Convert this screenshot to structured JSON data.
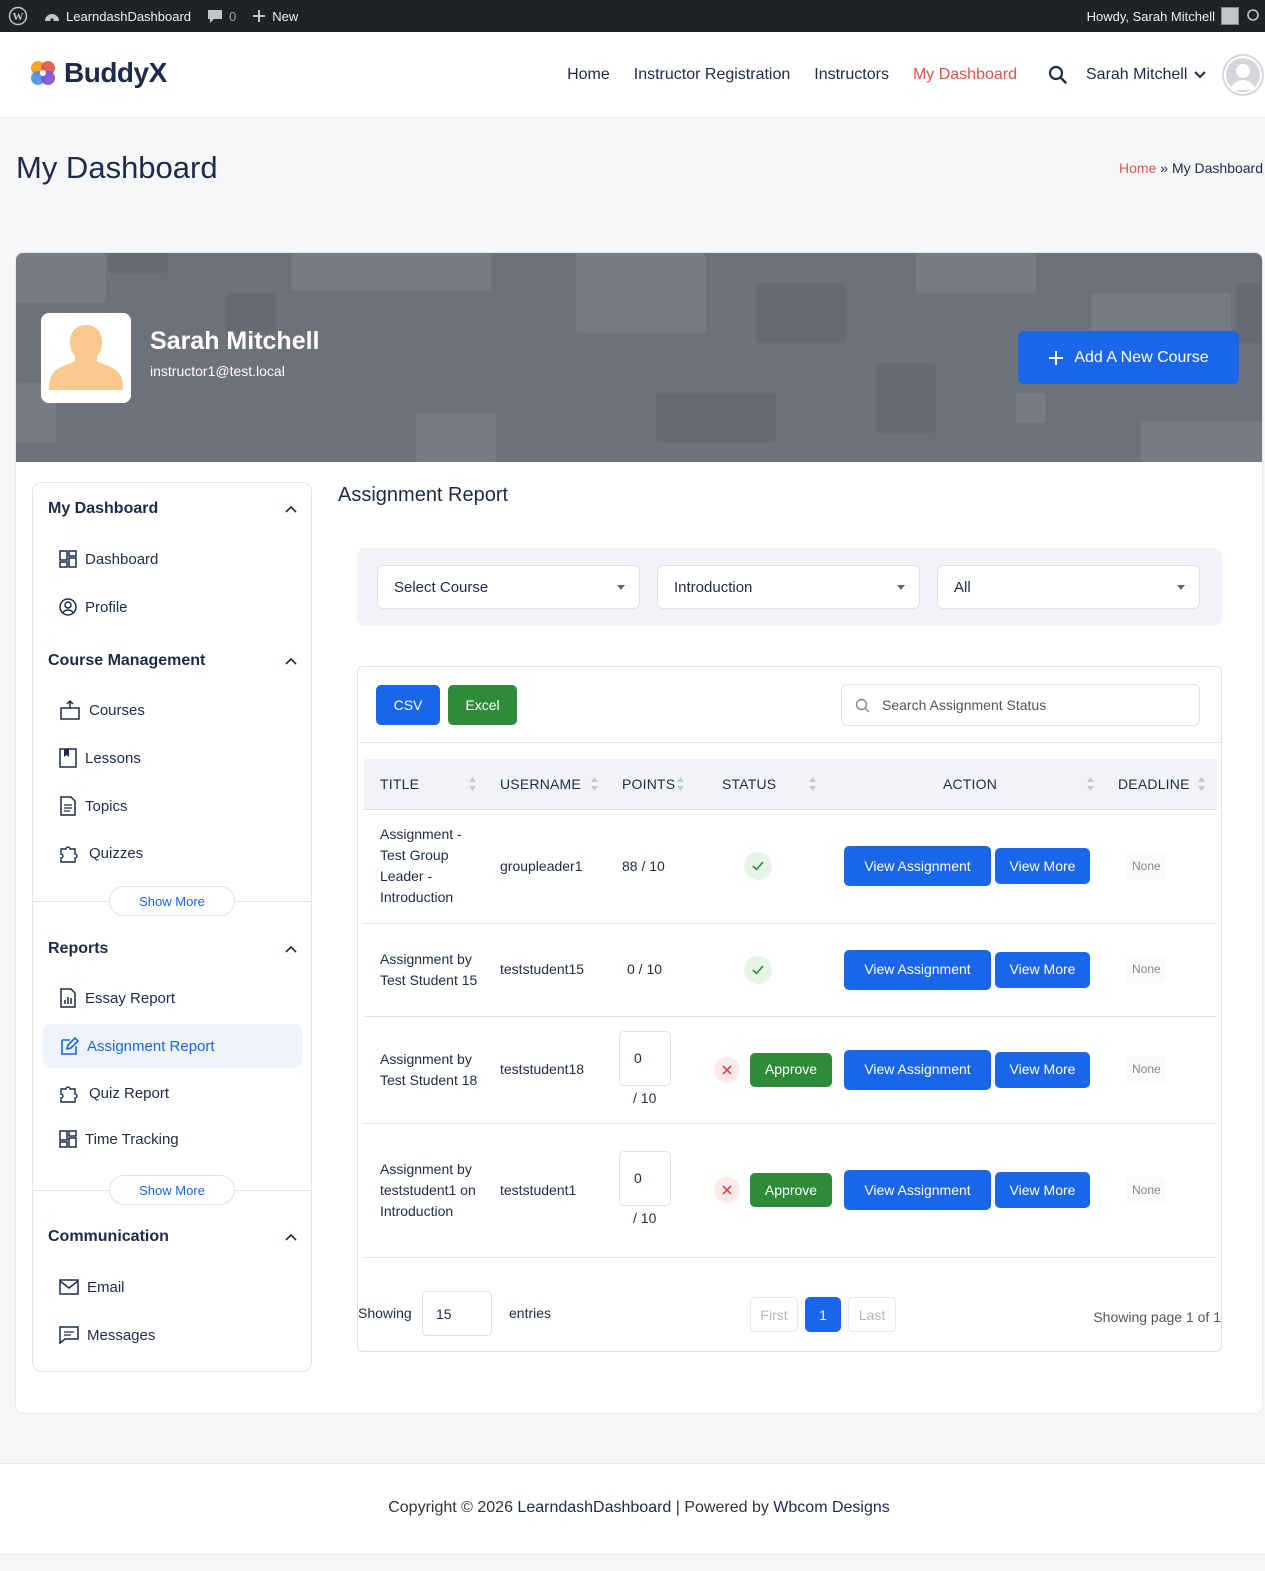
{
  "admin_bar": {
    "site_name": "LearndashDashboard",
    "comments_count": "0",
    "new_label": "New",
    "howdy": "Howdy, Sarah Mitchell"
  },
  "header": {
    "logo_text": "BuddyX",
    "nav": [
      {
        "label": "Home"
      },
      {
        "label": "Instructor Registration"
      },
      {
        "label": "Instructors"
      },
      {
        "label": "My Dashboard"
      }
    ],
    "user_name": "Sarah Mitchell"
  },
  "page": {
    "title": "My Dashboard",
    "breadcrumb_home": "Home",
    "breadcrumb_sep": " » ",
    "breadcrumb_current": "My Dashboard"
  },
  "profile": {
    "name": "Sarah Mitchell",
    "email": "instructor1@test.local",
    "add_course_label": "Add A New Course"
  },
  "sidebar": {
    "sections": [
      {
        "title": "My Dashboard",
        "items": [
          "Dashboard",
          "Profile"
        ]
      },
      {
        "title": "Course Management",
        "items": [
          "Courses",
          "Lessons",
          "Topics",
          "Quizzes"
        ],
        "more": "Show More"
      },
      {
        "title": "Reports",
        "items": [
          "Essay Report",
          "Assignment Report",
          "Quiz Report",
          "Time Tracking"
        ],
        "more": "Show More",
        "active": "Assignment Report"
      },
      {
        "title": "Communication",
        "items": [
          "Email",
          "Messages"
        ]
      }
    ]
  },
  "report": {
    "title": "Assignment Report",
    "filters": {
      "course": "Select Course",
      "lesson": "Introduction",
      "status": "All"
    },
    "csv_label": "CSV",
    "excel_label": "Excel",
    "search_placeholder": "Search Assignment Status",
    "columns": [
      "TITLE",
      "USERNAME",
      "POINTS",
      "STATUS",
      "ACTION",
      "DEADLINE"
    ],
    "rows": [
      {
        "title": "Assignment - Test Group Leader - Introduction",
        "username": "groupleader1",
        "points": "88 / 10",
        "status": "approved",
        "view_assignment": "View Assignment",
        "view_more": "View More",
        "deadline": "None"
      },
      {
        "title": "Assignment by Test Student 15",
        "username": "teststudent15",
        "points": "0 / 10",
        "status": "approved",
        "view_assignment": "View Assignment",
        "view_more": "View More",
        "deadline": "None"
      },
      {
        "title": "Assignment by Test Student 18",
        "username": "teststudent18",
        "points_value": "0",
        "points_max": "/ 10",
        "status": "pending",
        "approve_label": "Approve",
        "view_assignment": "View Assignment",
        "view_more": "View More",
        "deadline": "None"
      },
      {
        "title": "Assignment by teststudent1 on Introduction",
        "username": "teststudent1",
        "points_value": "0",
        "points_max": "/ 10",
        "status": "pending",
        "approve_label": "Approve",
        "view_assignment": "View Assignment",
        "view_more": "View More",
        "deadline": "None"
      }
    ],
    "footer": {
      "showing_label": "Showing",
      "page_length": "15",
      "entries_label": "entries",
      "first_label": "First",
      "current_page": "1",
      "last_label": "Last",
      "page_info": "Showing page 1 of 1"
    }
  },
  "footer": {
    "copyright_prefix": "Copyright © 2026 ",
    "site_link": "LearndashDashboard",
    "powered_prefix": " | Powered by ",
    "powered_link": "Wbcom Designs"
  },
  "colors": {
    "accent": "#1a66e8",
    "success": "#2e8b3a",
    "nav_active": "#e0534a",
    "admin_bar": "#1d2327"
  }
}
